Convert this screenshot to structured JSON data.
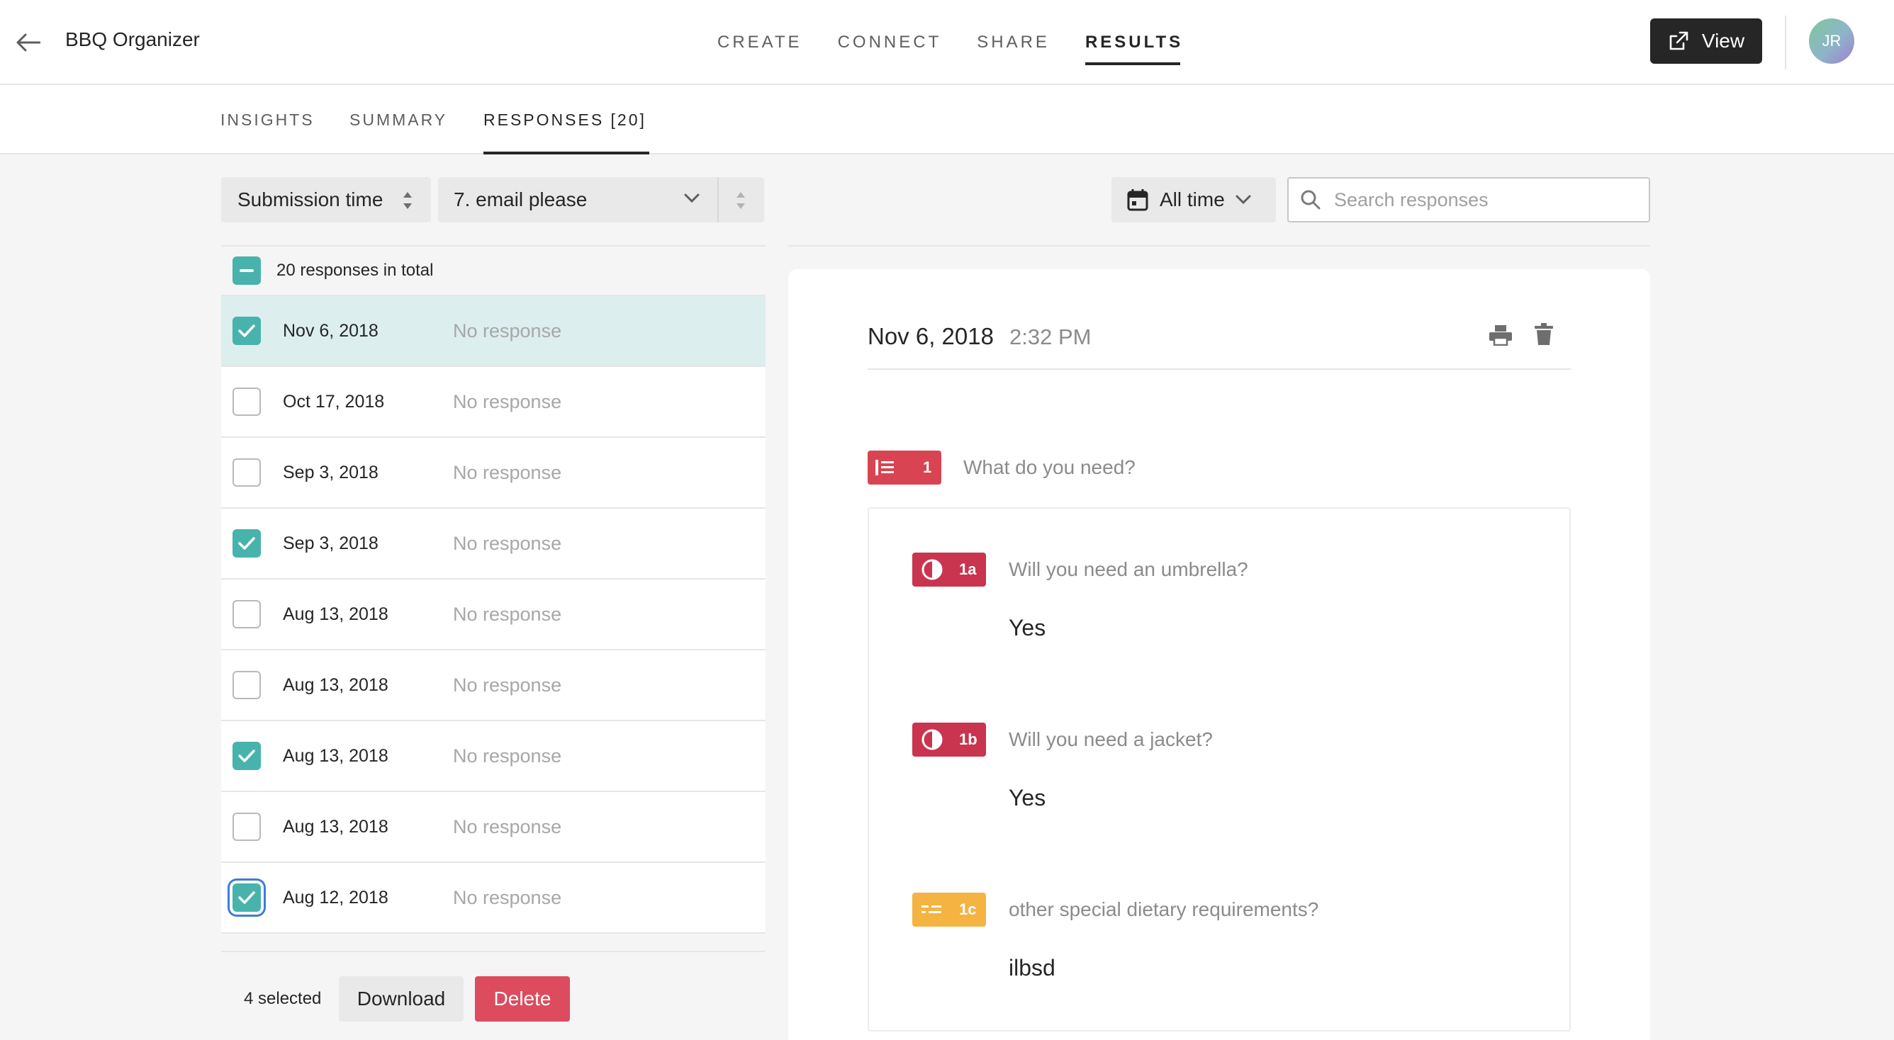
{
  "header": {
    "back_icon": "arrow-left-icon",
    "app_title": "BBQ Organizer",
    "tabs": [
      "CREATE",
      "CONNECT",
      "SHARE",
      "RESULTS"
    ],
    "active_tab": "RESULTS",
    "view_label": "View",
    "avatar_initials": "JR"
  },
  "subtabs": {
    "items": [
      "INSIGHTS",
      "SUMMARY",
      "RESPONSES [20]"
    ],
    "active": "RESPONSES [20]"
  },
  "filters": {
    "sort_label": "Submission time",
    "question_label": "7. email please",
    "date_label": "All time",
    "search_placeholder": "Search responses"
  },
  "list": {
    "total_label": "20 responses in total",
    "rows": [
      {
        "date": "Nov 6, 2018",
        "response": "No response",
        "checked": true
      },
      {
        "date": "Oct 17, 2018",
        "response": "No response",
        "checked": false
      },
      {
        "date": "Sep 3, 2018",
        "response": "No response",
        "checked": false
      },
      {
        "date": "Sep 3, 2018",
        "response": "No response",
        "checked": true
      },
      {
        "date": "Aug 13, 2018",
        "response": "No response",
        "checked": false
      },
      {
        "date": "Aug 13, 2018",
        "response": "No response",
        "checked": false
      },
      {
        "date": "Aug 13, 2018",
        "response": "No response",
        "checked": true
      },
      {
        "date": "Aug 13, 2018",
        "response": "No response",
        "checked": false
      },
      {
        "date": "Aug 12, 2018",
        "response": "No response",
        "checked": true
      }
    ],
    "selected_label": "4 selected",
    "download_label": "Download",
    "delete_label": "Delete"
  },
  "detail": {
    "date": "Nov 6, 2018",
    "time": "2:32 PM",
    "group": {
      "badge": "1",
      "question": "What do you need?",
      "color": "#d94452"
    },
    "questions": [
      {
        "badge": "1a",
        "question": "Will you need an umbrella?",
        "answer": "Yes",
        "color": "#c9344f"
      },
      {
        "badge": "1b",
        "question": "Will you need a jacket?",
        "answer": "Yes",
        "color": "#c9344f"
      },
      {
        "badge": "1c",
        "question": "other special dietary requirements?",
        "answer": "ilbsd",
        "color": "#f5b342"
      }
    ]
  },
  "colors": {
    "accent_teal": "#47b3ac",
    "delete_red": "#dd4b5e",
    "dark": "#262627"
  }
}
